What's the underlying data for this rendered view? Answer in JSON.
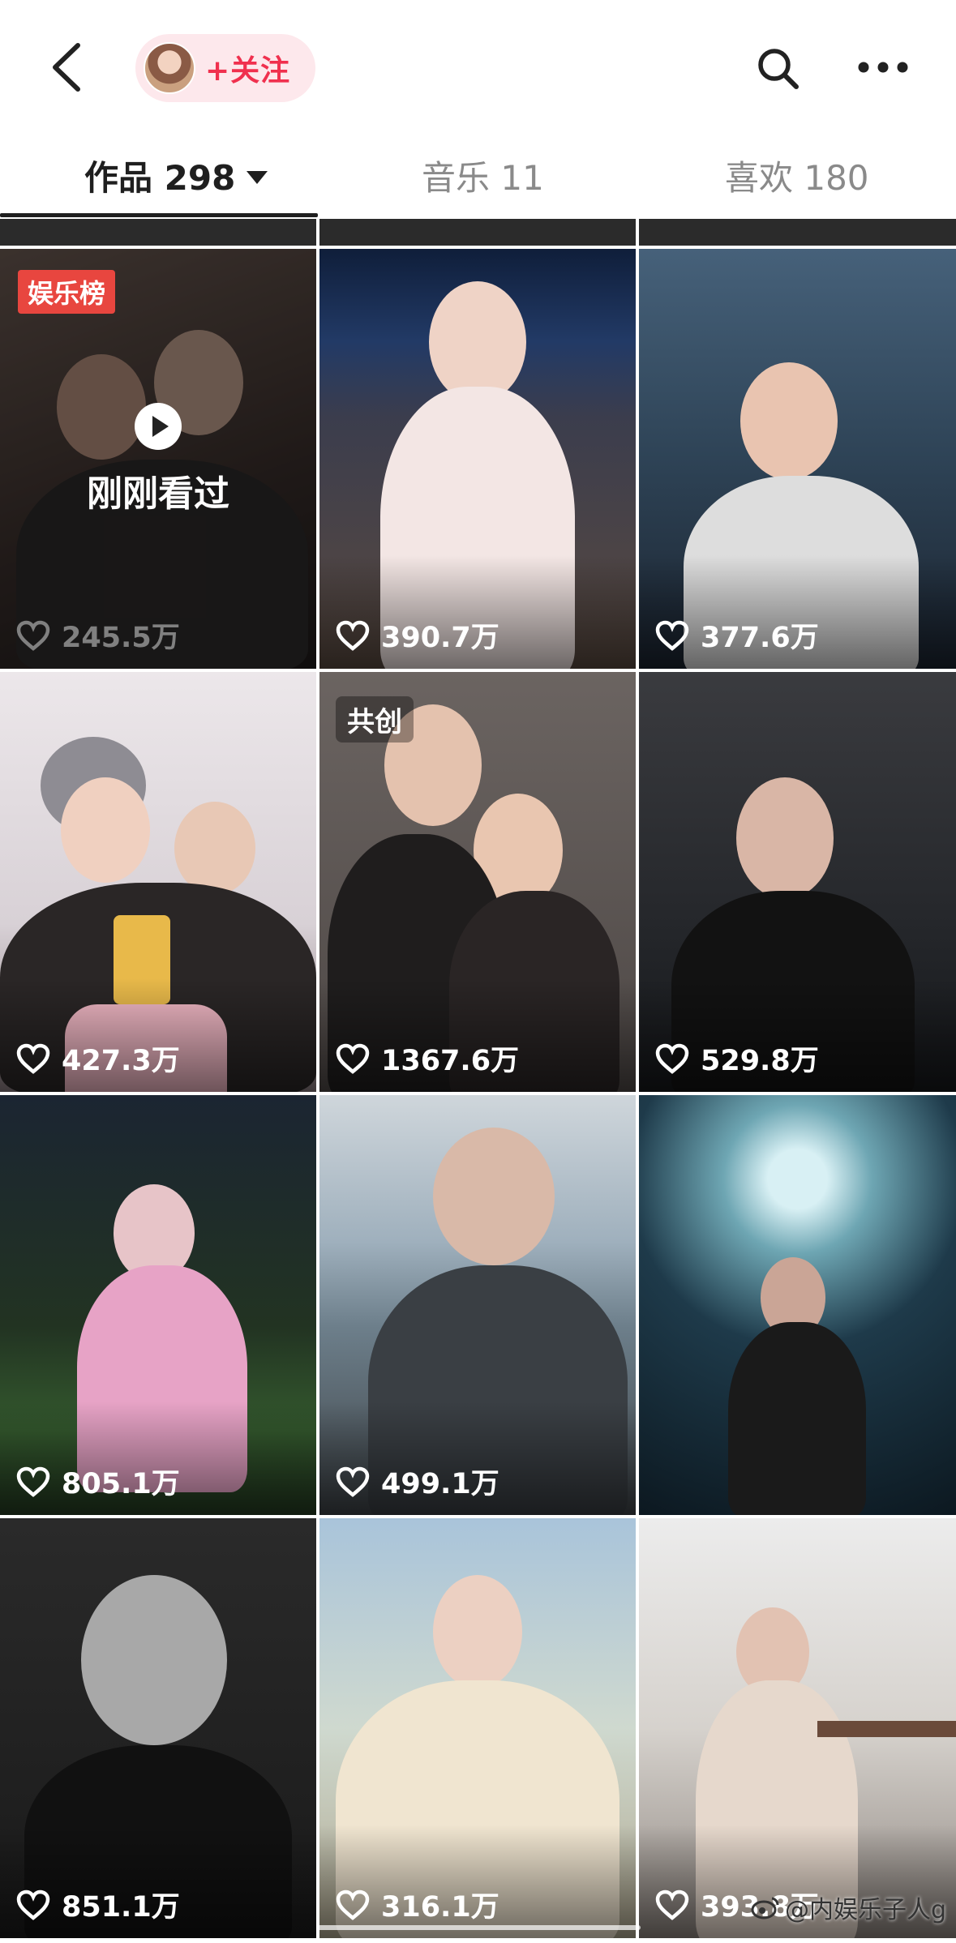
{
  "header": {
    "follow_label": "+关注",
    "icons": [
      "back-icon",
      "avatar",
      "search-icon",
      "more-icon"
    ]
  },
  "tabs": [
    {
      "label": "作品 298",
      "active": true
    },
    {
      "label": "音乐 11",
      "active": false
    },
    {
      "label": "喜欢 180",
      "active": false
    }
  ],
  "grid": {
    "tiles": [
      {
        "likes": "245.5万",
        "badge": "娱乐榜",
        "overlay": "刚刚看过"
      },
      {
        "likes": "390.7万"
      },
      {
        "likes": "377.6万"
      },
      {
        "likes": "427.3万"
      },
      {
        "likes": "1367.6万",
        "badge": "共创"
      },
      {
        "likes": "529.8万"
      },
      {
        "likes": "805.1万"
      },
      {
        "likes": "499.1万"
      },
      {
        "likes": ""
      },
      {
        "likes": "851.1万"
      },
      {
        "likes": "316.1万"
      },
      {
        "likes": "393.8万"
      }
    ]
  },
  "watermark": "@内娱乐子人g",
  "colors": {
    "accent": "#f0304e",
    "follow_bg": "#fde8ec",
    "rank_badge": "#e8463f"
  }
}
